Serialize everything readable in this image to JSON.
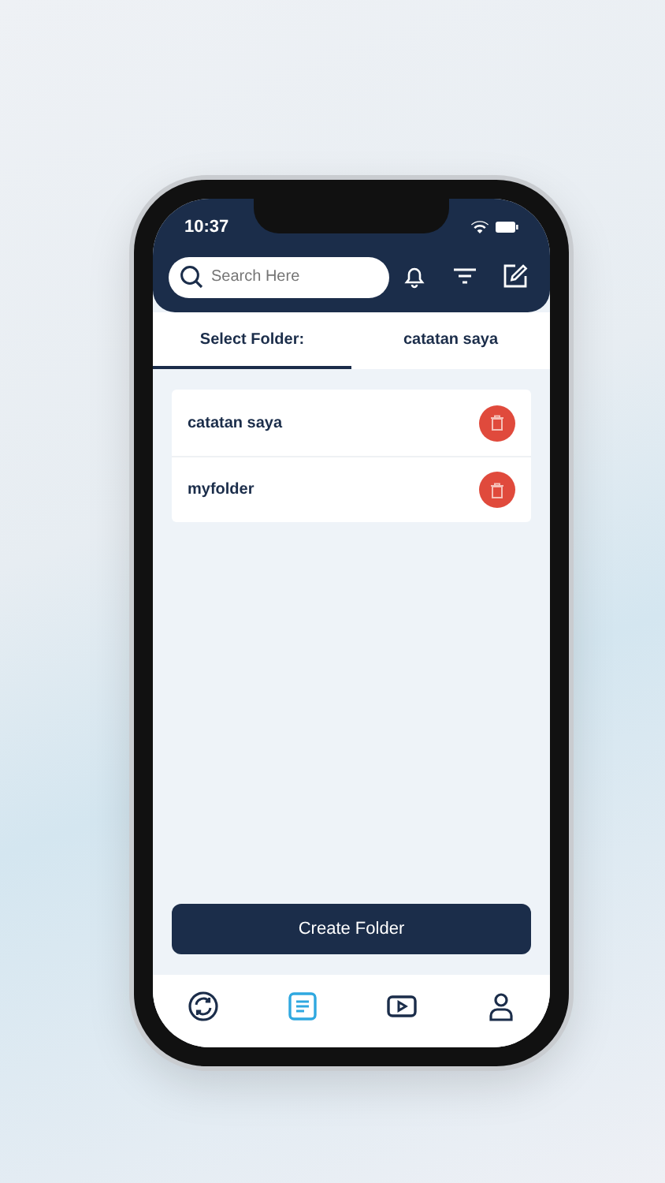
{
  "status_bar": {
    "time": "10:37"
  },
  "search": {
    "placeholder": "Search Here"
  },
  "tabs": [
    {
      "label": "Select Folder:",
      "selected": true
    },
    {
      "label": "catatan saya",
      "selected": false
    }
  ],
  "folders": [
    {
      "name": "catatan saya"
    },
    {
      "name": "myfolder"
    }
  ],
  "create_button": "Create Folder",
  "bottom_nav": [
    {
      "kind": "sync",
      "selected": false
    },
    {
      "kind": "notes",
      "selected": true
    },
    {
      "kind": "video",
      "selected": false
    },
    {
      "kind": "profile",
      "selected": false
    }
  ]
}
